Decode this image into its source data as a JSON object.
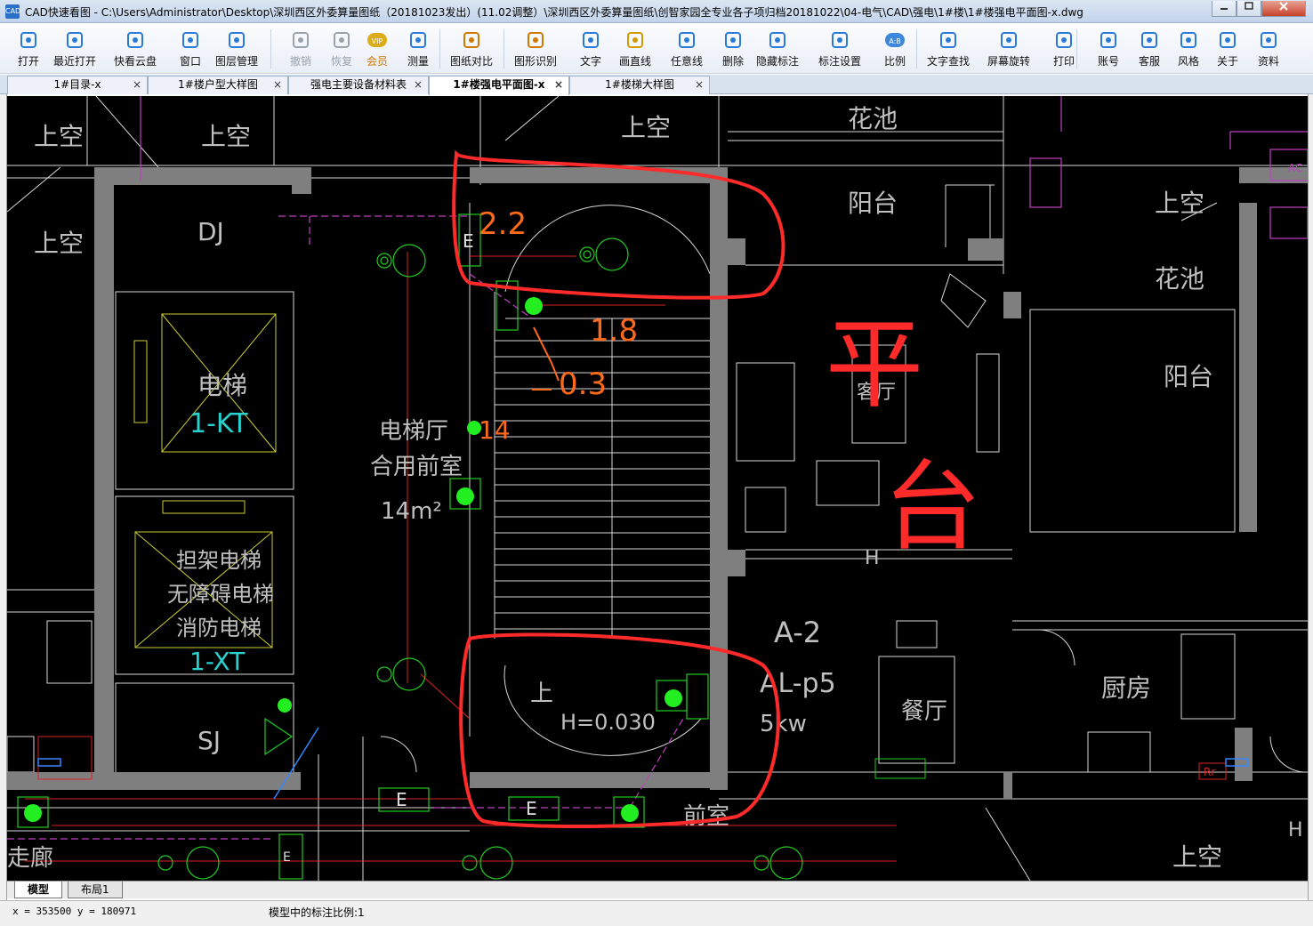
{
  "window": {
    "title": "CAD快速看图 - C:\\Users\\Administrator\\Desktop\\深圳西区外委算量图纸（20181023发出）(11.02调整）\\深圳西区外委算量图纸\\创智家园全专业各子项归档20181022\\04-电气\\CAD\\强电\\1#楼\\1#楼强电平面图-x.dwg",
    "icon_text": "CAD",
    "minimize_icon": "minimize-icon",
    "maximize_icon": "maximize-icon",
    "close_icon": "close-icon"
  },
  "toolbar": {
    "items": [
      {
        "label": "打开",
        "icon": "folder-open-icon"
      },
      {
        "label": "最近打开",
        "icon": "recent-clock-icon"
      },
      {
        "label": "快看云盘",
        "icon": "cloud-icon"
      },
      {
        "label": "窗口",
        "icon": "window-fit-icon"
      },
      {
        "label": "图层管理",
        "icon": "layers-icon"
      },
      {
        "label": "撤销",
        "icon": "undo-icon",
        "disabled": true
      },
      {
        "label": "恢复",
        "icon": "redo-icon",
        "disabled": true
      },
      {
        "label": "会员",
        "icon": "vip-icon",
        "highlight": true,
        "badge": "VIP"
      },
      {
        "label": "测量",
        "icon": "ruler-icon"
      },
      {
        "label": "图纸对比",
        "icon": "compare-icon"
      },
      {
        "label": "图形识别",
        "icon": "shape-recognize-icon"
      },
      {
        "label": "文字",
        "icon": "text-icon"
      },
      {
        "label": "画直线",
        "icon": "line-icon"
      },
      {
        "label": "任意线",
        "icon": "freehand-pen-icon"
      },
      {
        "label": "删除",
        "icon": "eraser-icon"
      },
      {
        "label": "隐藏标注",
        "icon": "hide-eye-icon"
      },
      {
        "label": "标注设置",
        "icon": "annotation-settings-icon"
      },
      {
        "label": "比例",
        "icon": "scale-icon",
        "badge": "A:B"
      },
      {
        "label": "文字查找",
        "icon": "text-search-icon"
      },
      {
        "label": "屏幕旋转",
        "icon": "rotate-screen-icon"
      },
      {
        "label": "打印",
        "icon": "printer-icon"
      },
      {
        "label": "账号",
        "icon": "user-icon"
      },
      {
        "label": "客服",
        "icon": "headset-icon"
      },
      {
        "label": "风格",
        "icon": "style-icon"
      },
      {
        "label": "关于",
        "icon": "info-icon"
      },
      {
        "label": "资料",
        "icon": "book-icon"
      }
    ]
  },
  "tabs": [
    {
      "label": "1#目录-x",
      "active": false
    },
    {
      "label": "1#楼户型大样图",
      "active": false
    },
    {
      "label": "强电主要设备材料表",
      "active": false
    },
    {
      "label": "1#楼强电平面图-x",
      "active": true
    },
    {
      "label": "1#楼梯大样图",
      "active": false
    }
  ],
  "tab_close_glyph": "×",
  "drawing": {
    "labels": {
      "shangkong": "上空",
      "huachi": "花池",
      "yangtai": "阳台",
      "dj": "DJ",
      "dianti": "电梯",
      "kt": "1-KT",
      "danjia1": "担架电梯",
      "danjia2": "无障碍电梯",
      "danjia3": "消防电梯",
      "xt": "1-XT",
      "sj": "SJ",
      "hall1": "电梯厅",
      "hall2": "合用前室",
      "hall3": "14m²",
      "e": "E",
      "shang": "上",
      "elev": "H=0.030",
      "a2": "A-2",
      "alp5": "AL-p5",
      "kw": "5kw",
      "canting": "餐厅",
      "chufang": "厨房",
      "qianshi": "前室",
      "zoulang": "走廊",
      "h": "H",
      "ac": "AC",
      "rr": "Rr",
      "keting": "客厅",
      "ann_22": "2.2",
      "ann_18": "1.8",
      "ann_03": "0.3",
      "ann_14": "14",
      "hw_ping": "平",
      "hw_tai": "台"
    }
  },
  "layouts": [
    {
      "label": "模型",
      "active": true
    },
    {
      "label": "布局1",
      "active": false
    }
  ],
  "status": {
    "coords": "x = 353500 y = 180971",
    "scale": "模型中的标注比例:1"
  }
}
